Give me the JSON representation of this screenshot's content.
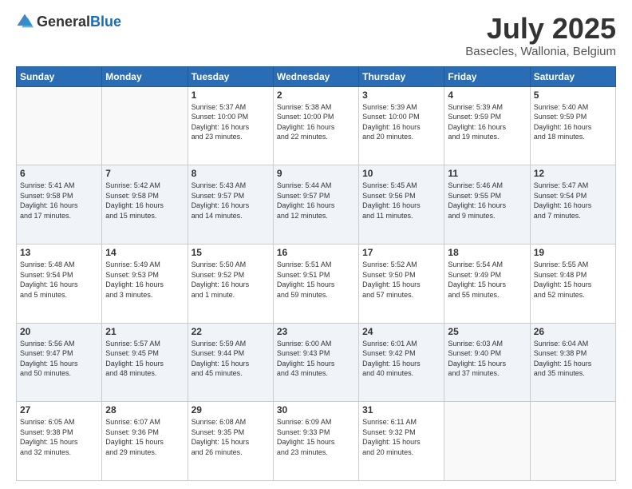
{
  "header": {
    "logo": {
      "general": "General",
      "blue": "Blue"
    },
    "title": "July 2025",
    "location": "Basecles, Wallonia, Belgium"
  },
  "days_header": [
    "Sunday",
    "Monday",
    "Tuesday",
    "Wednesday",
    "Thursday",
    "Friday",
    "Saturday"
  ],
  "weeks": [
    {
      "days": [
        {
          "num": "",
          "info": ""
        },
        {
          "num": "",
          "info": ""
        },
        {
          "num": "1",
          "info": "Sunrise: 5:37 AM\nSunset: 10:00 PM\nDaylight: 16 hours\nand 23 minutes."
        },
        {
          "num": "2",
          "info": "Sunrise: 5:38 AM\nSunset: 10:00 PM\nDaylight: 16 hours\nand 22 minutes."
        },
        {
          "num": "3",
          "info": "Sunrise: 5:39 AM\nSunset: 10:00 PM\nDaylight: 16 hours\nand 20 minutes."
        },
        {
          "num": "4",
          "info": "Sunrise: 5:39 AM\nSunset: 9:59 PM\nDaylight: 16 hours\nand 19 minutes."
        },
        {
          "num": "5",
          "info": "Sunrise: 5:40 AM\nSunset: 9:59 PM\nDaylight: 16 hours\nand 18 minutes."
        }
      ]
    },
    {
      "days": [
        {
          "num": "6",
          "info": "Sunrise: 5:41 AM\nSunset: 9:58 PM\nDaylight: 16 hours\nand 17 minutes."
        },
        {
          "num": "7",
          "info": "Sunrise: 5:42 AM\nSunset: 9:58 PM\nDaylight: 16 hours\nand 15 minutes."
        },
        {
          "num": "8",
          "info": "Sunrise: 5:43 AM\nSunset: 9:57 PM\nDaylight: 16 hours\nand 14 minutes."
        },
        {
          "num": "9",
          "info": "Sunrise: 5:44 AM\nSunset: 9:57 PM\nDaylight: 16 hours\nand 12 minutes."
        },
        {
          "num": "10",
          "info": "Sunrise: 5:45 AM\nSunset: 9:56 PM\nDaylight: 16 hours\nand 11 minutes."
        },
        {
          "num": "11",
          "info": "Sunrise: 5:46 AM\nSunset: 9:55 PM\nDaylight: 16 hours\nand 9 minutes."
        },
        {
          "num": "12",
          "info": "Sunrise: 5:47 AM\nSunset: 9:54 PM\nDaylight: 16 hours\nand 7 minutes."
        }
      ]
    },
    {
      "days": [
        {
          "num": "13",
          "info": "Sunrise: 5:48 AM\nSunset: 9:54 PM\nDaylight: 16 hours\nand 5 minutes."
        },
        {
          "num": "14",
          "info": "Sunrise: 5:49 AM\nSunset: 9:53 PM\nDaylight: 16 hours\nand 3 minutes."
        },
        {
          "num": "15",
          "info": "Sunrise: 5:50 AM\nSunset: 9:52 PM\nDaylight: 16 hours\nand 1 minute."
        },
        {
          "num": "16",
          "info": "Sunrise: 5:51 AM\nSunset: 9:51 PM\nDaylight: 15 hours\nand 59 minutes."
        },
        {
          "num": "17",
          "info": "Sunrise: 5:52 AM\nSunset: 9:50 PM\nDaylight: 15 hours\nand 57 minutes."
        },
        {
          "num": "18",
          "info": "Sunrise: 5:54 AM\nSunset: 9:49 PM\nDaylight: 15 hours\nand 55 minutes."
        },
        {
          "num": "19",
          "info": "Sunrise: 5:55 AM\nSunset: 9:48 PM\nDaylight: 15 hours\nand 52 minutes."
        }
      ]
    },
    {
      "days": [
        {
          "num": "20",
          "info": "Sunrise: 5:56 AM\nSunset: 9:47 PM\nDaylight: 15 hours\nand 50 minutes."
        },
        {
          "num": "21",
          "info": "Sunrise: 5:57 AM\nSunset: 9:45 PM\nDaylight: 15 hours\nand 48 minutes."
        },
        {
          "num": "22",
          "info": "Sunrise: 5:59 AM\nSunset: 9:44 PM\nDaylight: 15 hours\nand 45 minutes."
        },
        {
          "num": "23",
          "info": "Sunrise: 6:00 AM\nSunset: 9:43 PM\nDaylight: 15 hours\nand 43 minutes."
        },
        {
          "num": "24",
          "info": "Sunrise: 6:01 AM\nSunset: 9:42 PM\nDaylight: 15 hours\nand 40 minutes."
        },
        {
          "num": "25",
          "info": "Sunrise: 6:03 AM\nSunset: 9:40 PM\nDaylight: 15 hours\nand 37 minutes."
        },
        {
          "num": "26",
          "info": "Sunrise: 6:04 AM\nSunset: 9:38 PM\nDaylight: 15 hours\nand 35 minutes."
        }
      ]
    },
    {
      "days": [
        {
          "num": "27",
          "info": "Sunrise: 6:05 AM\nSunset: 9:38 PM\nDaylight: 15 hours\nand 32 minutes."
        },
        {
          "num": "28",
          "info": "Sunrise: 6:07 AM\nSunset: 9:36 PM\nDaylight: 15 hours\nand 29 minutes."
        },
        {
          "num": "29",
          "info": "Sunrise: 6:08 AM\nSunset: 9:35 PM\nDaylight: 15 hours\nand 26 minutes."
        },
        {
          "num": "30",
          "info": "Sunrise: 6:09 AM\nSunset: 9:33 PM\nDaylight: 15 hours\nand 23 minutes."
        },
        {
          "num": "31",
          "info": "Sunrise: 6:11 AM\nSunset: 9:32 PM\nDaylight: 15 hours\nand 20 minutes."
        },
        {
          "num": "",
          "info": ""
        },
        {
          "num": "",
          "info": ""
        }
      ]
    }
  ]
}
